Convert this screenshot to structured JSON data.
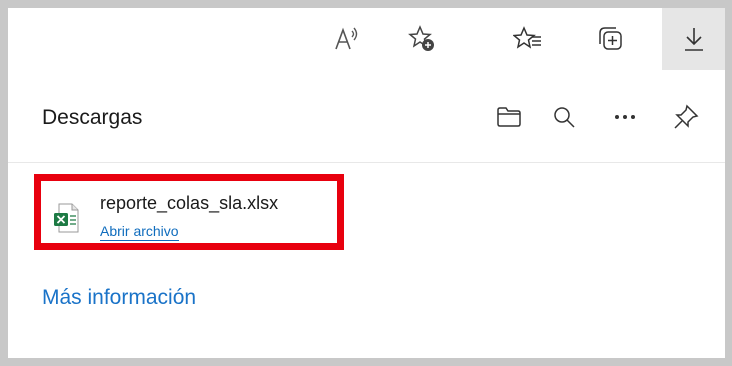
{
  "toolbar": {
    "icons": [
      "read-aloud-icon",
      "add-favorite-icon",
      "favorites-icon",
      "collections-icon",
      "downloads-icon"
    ]
  },
  "panel": {
    "title": "Descargas",
    "header_icons": [
      "open-folder-icon",
      "search-icon",
      "more-options-icon",
      "pin-icon"
    ]
  },
  "download": {
    "file_name": "reporte_colas_sla.xlsx",
    "action_label": "Abrir archivo",
    "file_icon": "excel-file-icon"
  },
  "footer": {
    "more_info_label": "Más información"
  },
  "colors": {
    "highlight": "#e8000e",
    "link": "#0f6cbd",
    "excel_green": "#1d7a44"
  }
}
